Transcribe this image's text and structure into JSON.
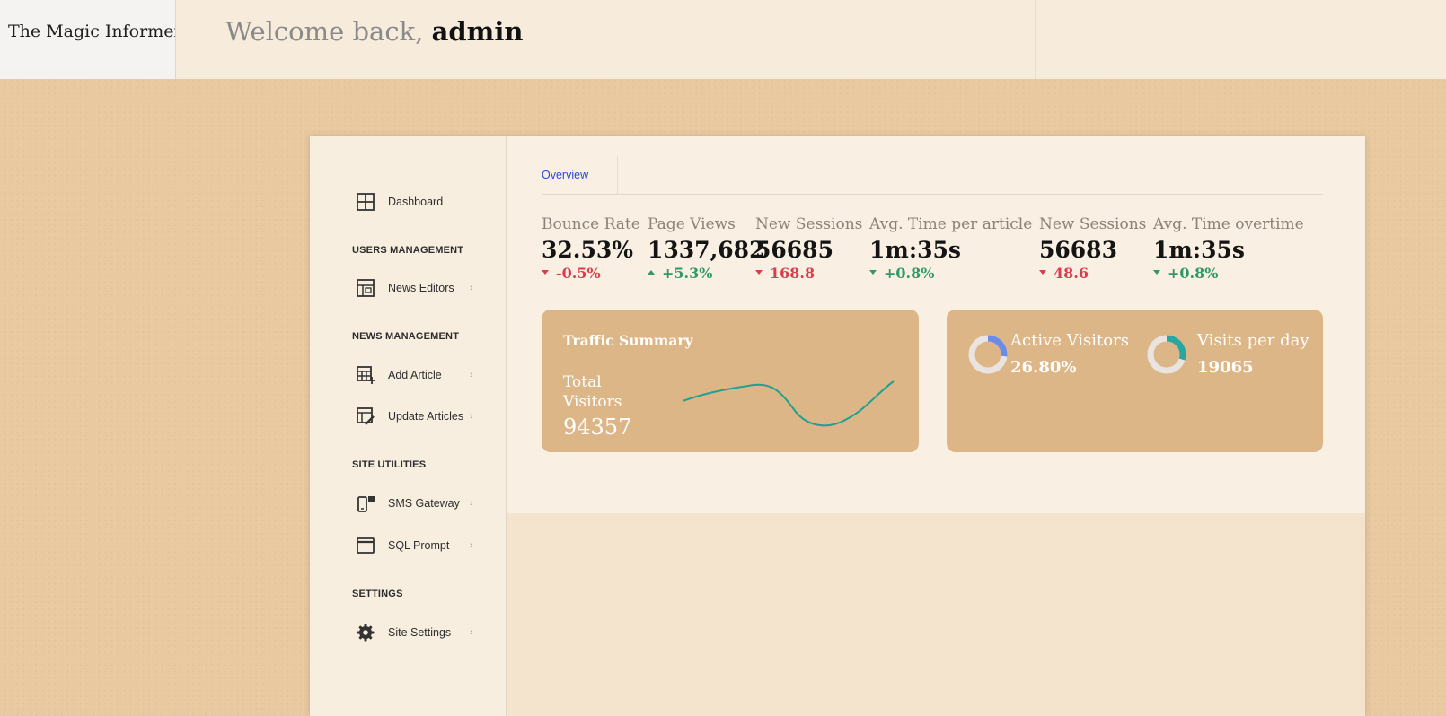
{
  "header": {
    "brand": "The Magic Informer",
    "welcome_prefix": "Welcome back, ",
    "username": "admin"
  },
  "sidebar": {
    "dashboard": "Dashboard",
    "sections": {
      "users": "USERS MANAGEMENT",
      "news": "NEWS MANAGEMENT",
      "utilities": "SITE UTILITIES",
      "settings": "SETTINGS"
    },
    "items": {
      "news_editors": "News Editors",
      "add_article": "Add Article",
      "update_articles": "Update Articles",
      "sms_gateway": "SMS Gateway",
      "sql_prompt": "SQL Prompt",
      "site_settings": "Site Settings"
    },
    "chevron": "›"
  },
  "main": {
    "tab": "Overview",
    "stats": [
      {
        "label": "Bounce Rate",
        "value": "32.53%",
        "change": "-0.5%",
        "trend": "down"
      },
      {
        "label": "Page Views",
        "value": "1337,682",
        "change": "+5.3%",
        "trend": "up"
      },
      {
        "label": "New Sessions",
        "value": "56685",
        "change": "168.8",
        "trend": "down"
      },
      {
        "label": "Avg. Time per article",
        "value": "1m:35s",
        "change": "+0.8%",
        "trend": "up"
      },
      {
        "label": "New Sessions",
        "value": "56683",
        "change": "48.6",
        "trend": "down"
      },
      {
        "label": "Avg. Time overtime",
        "value": "1m:35s",
        "change": "+0.8%",
        "trend": "up"
      }
    ],
    "traffic": {
      "title": "Traffic Summary",
      "total_label": "Total Visitors",
      "total_value": "94357"
    },
    "active": {
      "label": "Active Visitors",
      "value": "26.80%",
      "fraction": 0.268,
      "color": "#6b8be6"
    },
    "visits": {
      "label": "Visits per day",
      "value": "19065",
      "fraction": 0.3,
      "color": "#2aa6a0"
    }
  },
  "colors": {
    "accent_blue": "#2c4bd1",
    "down_red": "#d93c4d",
    "up_green": "#2f9a63",
    "card_bg": "#ddb687",
    "sparkline": "#1fa192"
  }
}
